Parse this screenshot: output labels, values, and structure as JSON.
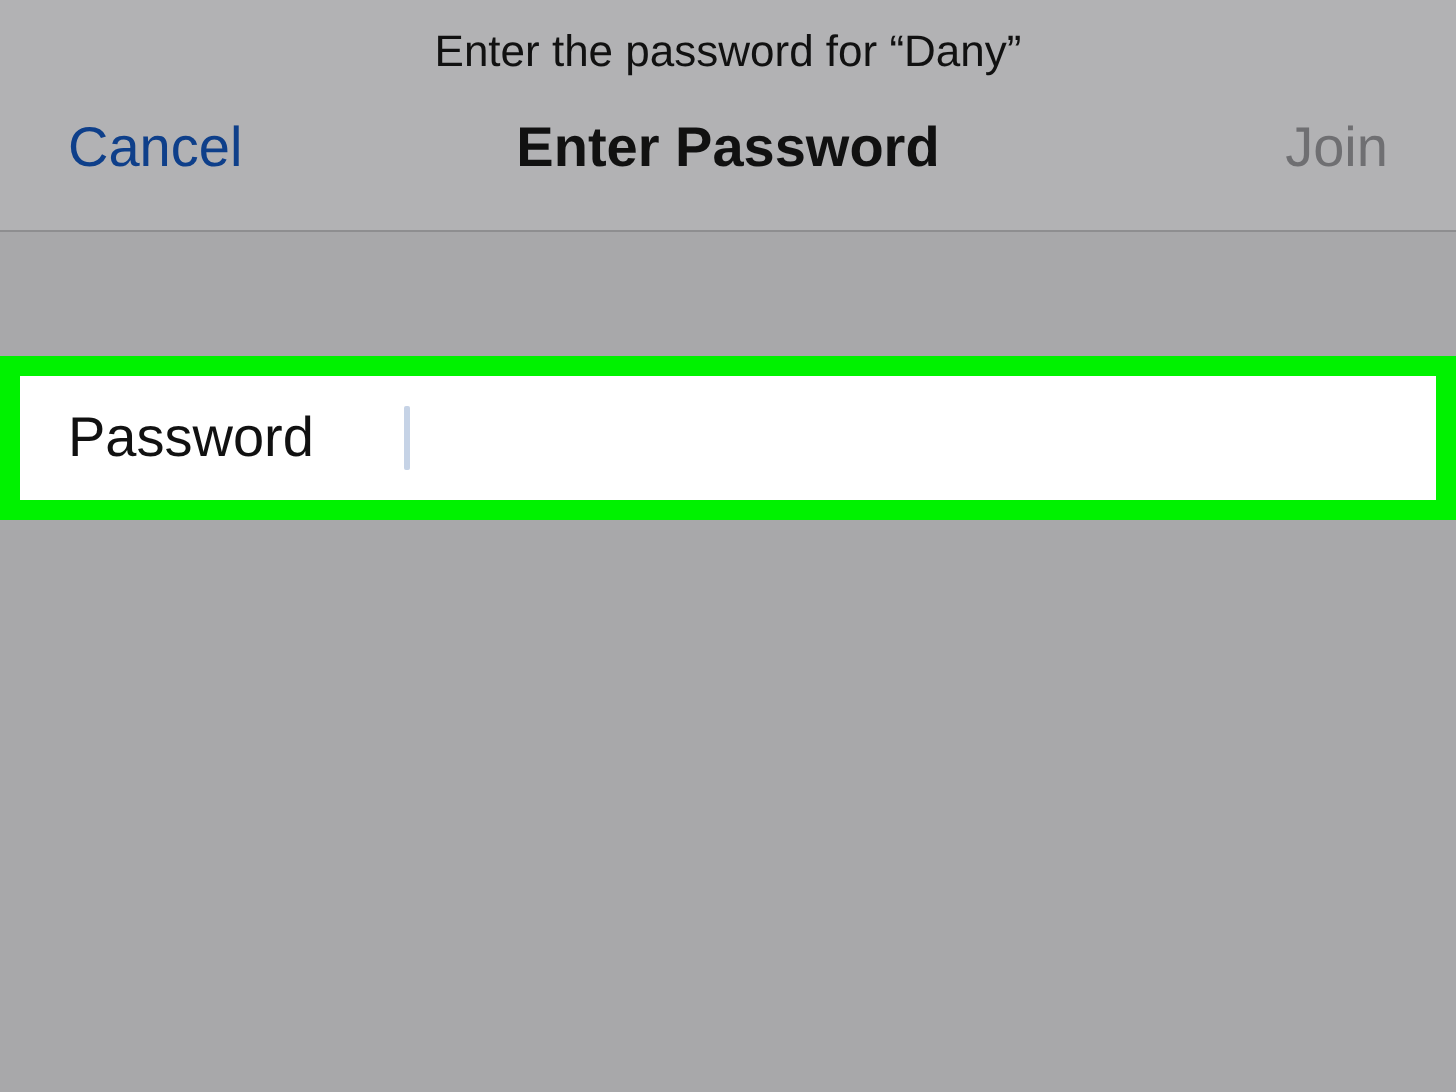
{
  "prompt": "Enter the password for “Dany”",
  "nav_bar": {
    "cancel": "Cancel",
    "title": "Enter Password",
    "join": {
      "label": "Join",
      "disabled": true
    }
  },
  "password_field": {
    "label": "Password",
    "focused": true,
    "highlighted": true
  }
}
